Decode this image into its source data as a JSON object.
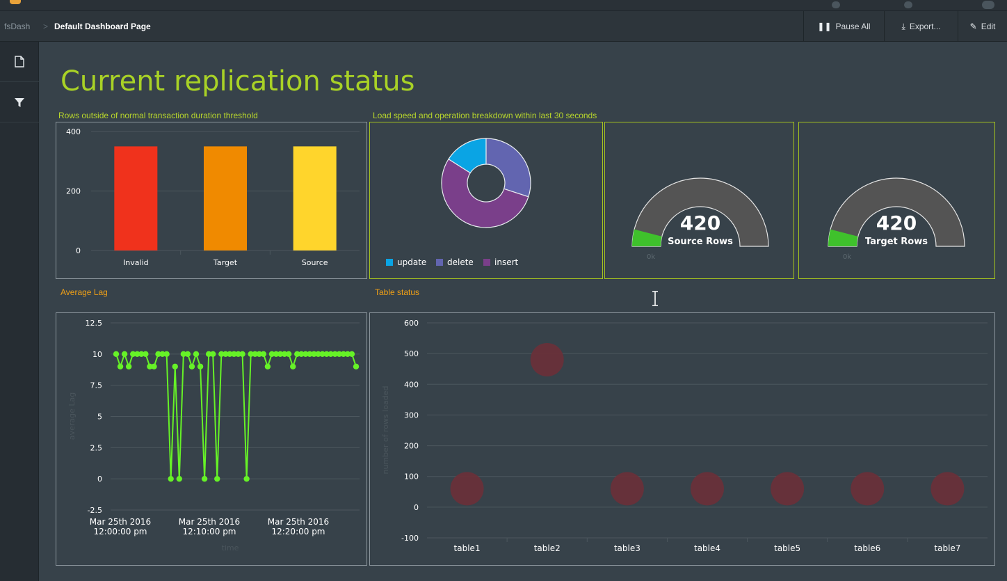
{
  "breadcrumb": {
    "root": "fsDash",
    "separator": ">",
    "page": "Default Dashboard Page"
  },
  "toolbar": {
    "pause_label": "Pause All",
    "export_label": "Export...",
    "edit_label": "Edit"
  },
  "page_title": "Current replication status",
  "sections": {
    "rows_threshold": "Rows outside of normal transaction duration threshold",
    "load_speed": "Load speed and operation breakdown within last 30 seconds",
    "average_lag": "Average Lag",
    "table_status": "Table status"
  },
  "colors": {
    "accent": "#a9d226",
    "section_orange": "#f0a016",
    "lag_line": "#66f227",
    "bubble": "#6a3038"
  },
  "gauges": [
    {
      "value": "420",
      "label": "Source Rows",
      "min_label": "0k",
      "fraction": 0.08
    },
    {
      "value": "420",
      "label": "Target Rows",
      "min_label": "0k",
      "fraction": 0.08
    }
  ],
  "chart_data": [
    {
      "type": "bar",
      "categories": [
        "Invalid",
        "Target",
        "Source"
      ],
      "values": [
        350,
        350,
        350
      ],
      "colors": [
        "#f0321c",
        "#f08a00",
        "#ffd52c"
      ],
      "ylim": [
        0,
        400
      ],
      "yticks": [
        0,
        200,
        400
      ],
      "grid": true
    },
    {
      "type": "pie",
      "labels": [
        "update",
        "delete",
        "insert"
      ],
      "values": [
        16,
        30,
        54
      ],
      "colors": [
        "#0aa4e4",
        "#6265b0",
        "#7a3f8a"
      ],
      "legend": "bottom-left"
    },
    {
      "type": "line",
      "xlabel": "time",
      "ylabel": "average Lag",
      "ylim": [
        -2.5,
        12.5
      ],
      "yticks": [
        -2.5,
        0,
        2.5,
        5,
        7.5,
        10,
        12.5
      ],
      "xticks": [
        "Mar 25th 2016\n12:00:00 pm",
        "Mar 25th 2016\n12:10:00 pm",
        "Mar 25th 2016\n12:20:00 pm"
      ],
      "y": [
        10,
        9,
        10,
        9,
        10,
        10,
        10,
        10,
        9,
        9,
        10,
        10,
        10,
        0,
        9,
        0,
        10,
        10,
        9,
        10,
        9,
        0,
        10,
        10,
        0,
        10,
        10,
        10,
        10,
        10,
        10,
        0,
        10,
        10,
        10,
        10,
        9,
        10,
        10,
        10,
        10,
        10,
        9,
        10,
        10,
        10,
        10,
        10,
        10,
        10,
        10,
        10,
        10,
        10,
        10,
        10,
        10,
        9
      ],
      "grid": true
    },
    {
      "type": "scatter",
      "xlabel": "",
      "ylabel": "number of rows loaded",
      "categories": [
        "table1",
        "table2",
        "table3",
        "table4",
        "table5",
        "table6",
        "table7"
      ],
      "values": [
        60,
        480,
        60,
        60,
        60,
        60,
        60
      ],
      "ylim": [
        -100,
        600
      ],
      "yticks": [
        -100,
        0,
        100,
        200,
        300,
        400,
        500,
        600
      ],
      "grid": true
    }
  ]
}
